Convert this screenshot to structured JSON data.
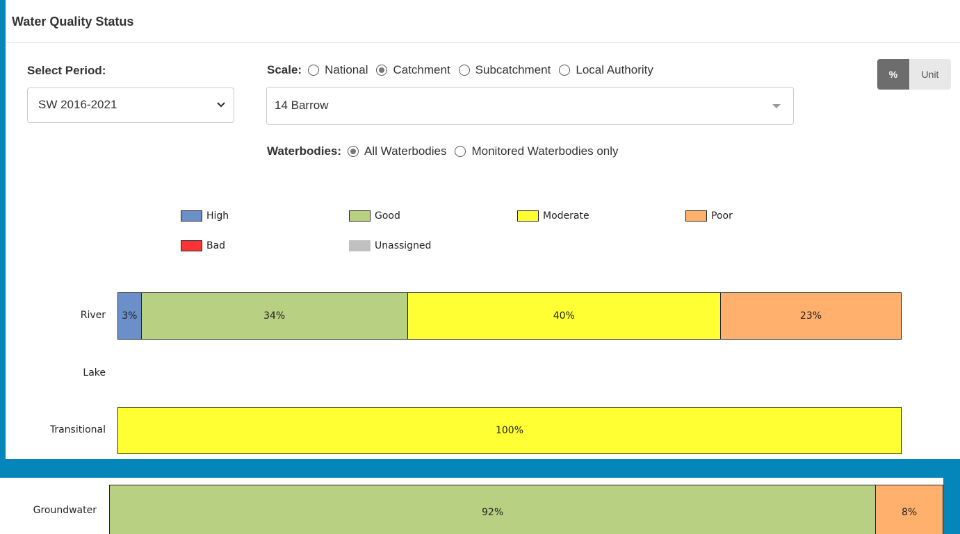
{
  "header": {
    "title": "Water Quality Status"
  },
  "filters": {
    "period_label": "Select Period:",
    "period_value": "SW 2016-2021",
    "scale_label": "Scale:",
    "scale_options": [
      {
        "label": "National",
        "selected": false
      },
      {
        "label": "Catchment",
        "selected": true
      },
      {
        "label": "Subcatchment",
        "selected": false
      },
      {
        "label": "Local Authority",
        "selected": false
      }
    ],
    "catchment_value": "14 Barrow",
    "waterbodies_label": "Waterbodies:",
    "waterbodies_options": [
      {
        "label": "All Waterbodies",
        "selected": true
      },
      {
        "label": "Monitored Waterbodies only",
        "selected": false
      }
    ]
  },
  "toggle": {
    "percent_label": "%",
    "unit_label": "Unit",
    "active": "%"
  },
  "legend": [
    {
      "label": "High",
      "color": "#6b8fc8"
    },
    {
      "label": "Good",
      "color": "#b8d081"
    },
    {
      "label": "Moderate",
      "color": "#ffff33"
    },
    {
      "label": "Poor",
      "color": "#ffb06c"
    },
    {
      "label": "Bad",
      "color": "#ff3333"
    },
    {
      "label": "Unassigned",
      "color": "#c0c0c0"
    }
  ],
  "chart_data": {
    "type": "bar",
    "orientation": "horizontal",
    "stacked": true,
    "unit": "%",
    "categories": [
      "River",
      "Lake",
      "Transitional",
      "Groundwater"
    ],
    "series": [
      {
        "name": "High",
        "color": "#6b8fc8",
        "values": [
          3,
          0,
          0,
          0
        ]
      },
      {
        "name": "Good",
        "color": "#b8d081",
        "values": [
          34,
          0,
          0,
          92
        ]
      },
      {
        "name": "Moderate",
        "color": "#ffff33",
        "values": [
          40,
          0,
          100,
          0
        ]
      },
      {
        "name": "Poor",
        "color": "#ffb06c",
        "values": [
          23,
          0,
          0,
          8
        ]
      },
      {
        "name": "Bad",
        "color": "#ff3333",
        "values": [
          0,
          0,
          0,
          0
        ]
      },
      {
        "name": "Unassigned",
        "color": "#c0c0c0",
        "values": [
          0,
          0,
          0,
          0
        ]
      }
    ],
    "data_labels": [
      [
        "3%",
        "34%",
        "40%",
        "23%"
      ],
      [],
      [
        "100%"
      ],
      [
        "92%",
        "8%"
      ]
    ],
    "xlim": [
      0,
      100
    ],
    "grid": false,
    "legend_position": "top"
  }
}
